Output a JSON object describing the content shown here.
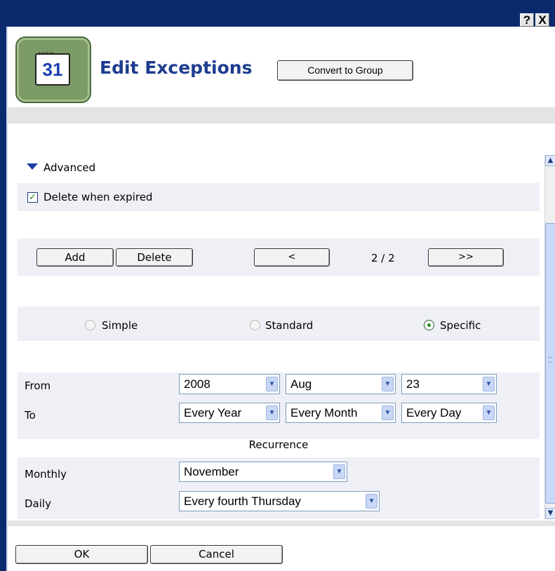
{
  "titlebar": {
    "help_glyph": "?",
    "close_glyph": "X"
  },
  "header": {
    "icon_number": "31",
    "title": "Edit Exceptions",
    "convert_label": "Convert to Group"
  },
  "advanced": {
    "label": "Advanced",
    "delete_expired_label": "Delete when expired",
    "delete_expired_checked": true
  },
  "toolbar": {
    "add_label": "Add",
    "delete_label": "Delete",
    "prev_label": "<",
    "page_text": "2 / 2",
    "next_label": ">>"
  },
  "mode": {
    "options": [
      "Simple",
      "Standard",
      "Specific"
    ],
    "selected": "Specific"
  },
  "from": {
    "label": "From",
    "year": "2008",
    "month": "Aug",
    "day": "23"
  },
  "to": {
    "label": "To",
    "year": "Every Year",
    "month": "Every Month",
    "day": "Every Day"
  },
  "recurrence": {
    "heading": "Recurrence",
    "monthly_label": "Monthly",
    "monthly_value": "November",
    "daily_label": "Daily",
    "daily_value": "Every fourth Thursday"
  },
  "footer": {
    "ok_label": "OK",
    "cancel_label": "Cancel"
  },
  "colors": {
    "titlebar": "#0a2a6e",
    "title_text": "#1e3d8f",
    "band": "#eef0f6",
    "accent": "#1a3fa0"
  }
}
